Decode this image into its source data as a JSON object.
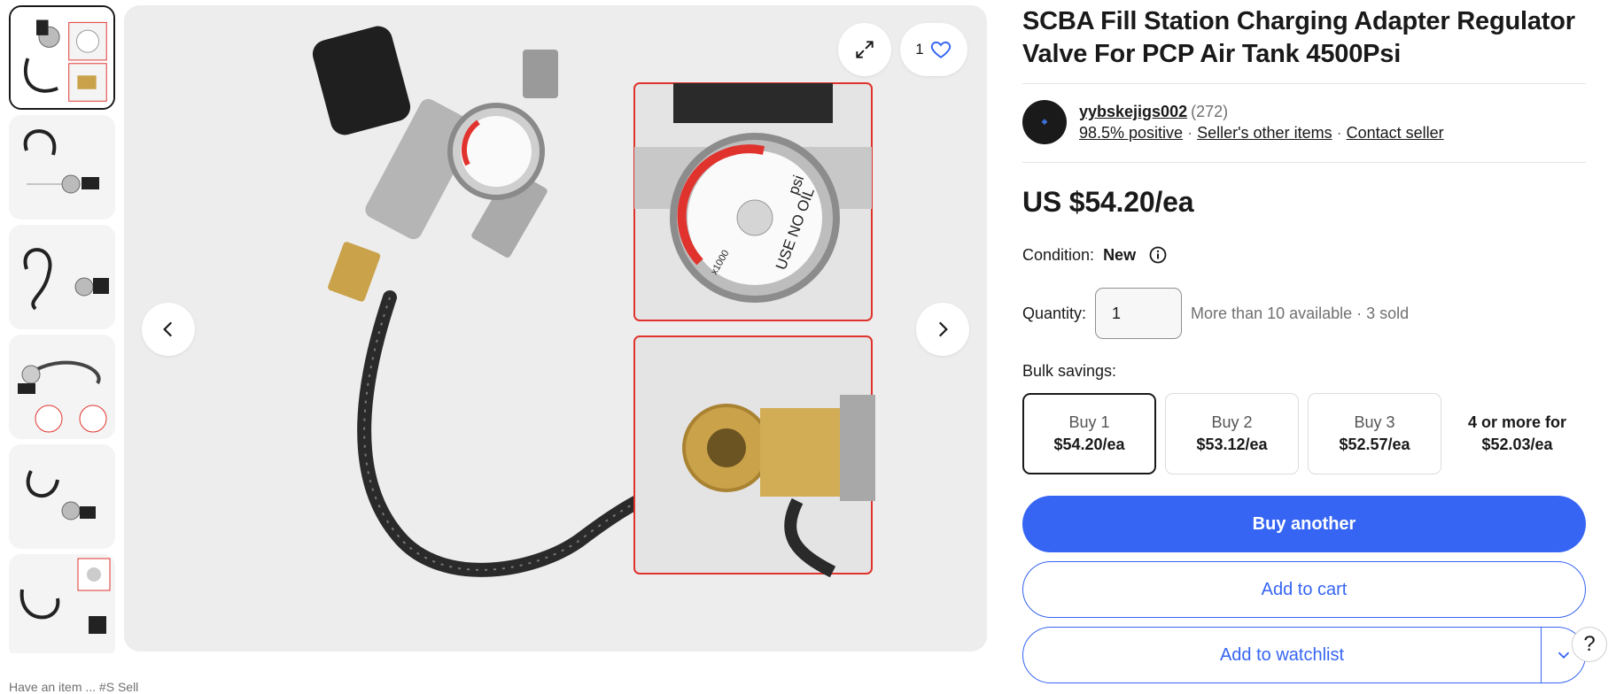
{
  "gallery": {
    "thumbnail_count": 6,
    "active_index": 0,
    "watch_count": "1"
  },
  "listing": {
    "title": "SCBA Fill Station Charging Adapter Regulator Valve For PCP Air Tank 4500Psi",
    "seller": {
      "name": "yybskejigs002",
      "feedback_count": "(272)",
      "positive": "98.5% positive",
      "other_items": "Seller's other items",
      "contact": "Contact seller"
    },
    "price": "US $54.20/ea",
    "condition_label": "Condition:",
    "condition_value": "New",
    "quantity_label": "Quantity:",
    "quantity_value": "1",
    "availability": "More than 10 available · 3 sold",
    "bulk_label": "Bulk savings:",
    "bulk_options": [
      {
        "qty": "Buy 1",
        "price": "$54.20/ea"
      },
      {
        "qty": "Buy 2",
        "price": "$53.12/ea"
      },
      {
        "qty": "Buy 3",
        "price": "$52.57/ea"
      },
      {
        "qty": "4 or more for",
        "price": "$52.03/ea"
      }
    ],
    "buy_label": "Buy another",
    "cart_label": "Add to cart",
    "watch_label": "Add to watchlist"
  },
  "gauge_labels": {
    "psi": "psi",
    "use_no_oil": "USE NO OIL",
    "x1000": "x1000"
  },
  "help_label": "?",
  "footer_partial": "Have an item ... #S Sell",
  "colors": {
    "accent": "#3665f3",
    "text": "#191919",
    "muted": "#707070",
    "inset_border": "#e0332d"
  }
}
